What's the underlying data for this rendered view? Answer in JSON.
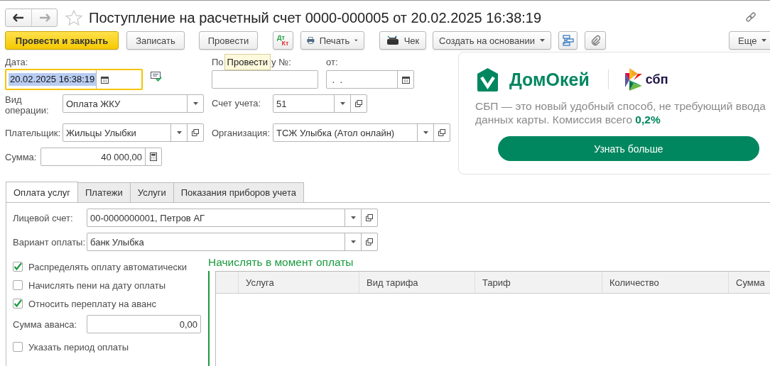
{
  "title": "Поступление на расчетный счет 0000-000005 от 20.02.2025 16:38:19",
  "toolbar": {
    "post_and_close": "Провести и закрыть",
    "save": "Записать",
    "post": "Провести",
    "dt": "Дт",
    "kt": "Кт",
    "print": "Печать",
    "receipt": "Чек",
    "create_based": "Создать на основании",
    "more": "Еще"
  },
  "form": {
    "date_label": "Дата:",
    "date_value": "20.02.2025 16:38:19",
    "date_focused": true,
    "incoming_label_start": "По",
    "tooltip": "Провести",
    "incoming_label_end": "у №:",
    "from_label": "от:",
    "from_value": " .  .",
    "operation_label": "Вид операции:",
    "operation_value": "Оплата ЖКУ",
    "account_label": "Счет учета:",
    "account_value": "51",
    "payer_label": "Плательщик:",
    "payer_value": "Жильцы Улыбки",
    "org_label": "Организация:",
    "org_value": "ТСЖ Улыбка (Атол онлайн)",
    "sum_label": "Сумма:",
    "sum_value": "40 000,00"
  },
  "ad": {
    "brand": "ДомОкей",
    "sbp": "сбп",
    "text": "СБП — это новый удобный способ, не требующий ввода данных карты. Комиссия всего **0,2%**",
    "button": "Узнать больше"
  },
  "tabs": [
    {
      "label": "Оплата услуг",
      "selected": true
    },
    {
      "label": "Платежи",
      "selected": false
    },
    {
      "label": "Услуги",
      "selected": false
    },
    {
      "label": "Показания приборов учета",
      "selected": false
    }
  ],
  "panel": {
    "account_label": "Лицевой счет:",
    "account_value": "00-0000000001, Петров АГ",
    "variant_label": "Вариант оплаты:",
    "variant_value": "банк Улыбка",
    "options": [
      {
        "kind": "checkbox",
        "label": "Распределять оплату автоматически",
        "checked": true
      },
      {
        "kind": "checkbox",
        "label": "Начислять пени на дату оплаты",
        "checked": false
      },
      {
        "kind": "checkbox",
        "label": "Относить переплату на аванс",
        "checked": true
      },
      {
        "kind": "field",
        "label": "Сумма аванса:",
        "value": "0,00"
      },
      {
        "kind": "checkbox",
        "label": "Указать период оплаты",
        "checked": false
      }
    ],
    "section_title": "Начислять в момент оплаты",
    "table": {
      "columns": [
        "Услуга",
        "Вид тарифа",
        "Тариф",
        "Количество",
        "Сумма"
      ]
    }
  }
}
